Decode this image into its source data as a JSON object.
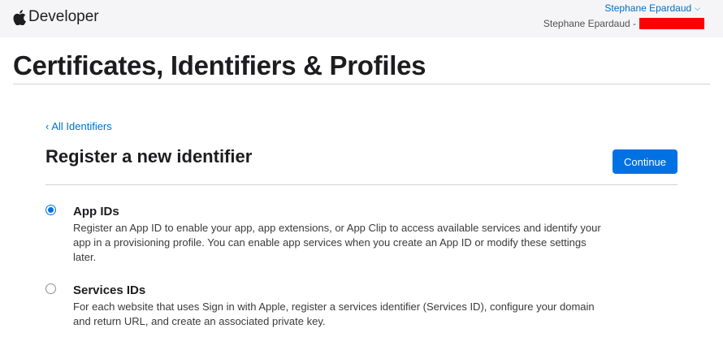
{
  "header": {
    "brand": "Developer",
    "account_name": "Stephane Epardaud",
    "team_label": "Stephane Epardaud -"
  },
  "page": {
    "title": "Certificates, Identifiers & Profiles"
  },
  "nav": {
    "back_link": "All Identifiers"
  },
  "section": {
    "title": "Register a new identifier",
    "continue_label": "Continue"
  },
  "options": [
    {
      "label": "App IDs",
      "selected": true,
      "description": "Register an App ID to enable your app, app extensions, or App Clip to access available services and identify your app in a provisioning profile. You can enable app services when you create an App ID or modify these settings later."
    },
    {
      "label": "Services IDs",
      "selected": false,
      "description": "For each website that uses Sign in with Apple, register a services identifier (Services ID), configure your domain and return URL, and create an associated private key."
    }
  ],
  "colors": {
    "accent": "#0071e3",
    "link": "#0070c9",
    "redaction": "#ff0000"
  },
  "icons": {
    "brand": "apple-logo-icon",
    "account_menu": "chevron-down-icon",
    "back": "chevron-left-icon"
  }
}
